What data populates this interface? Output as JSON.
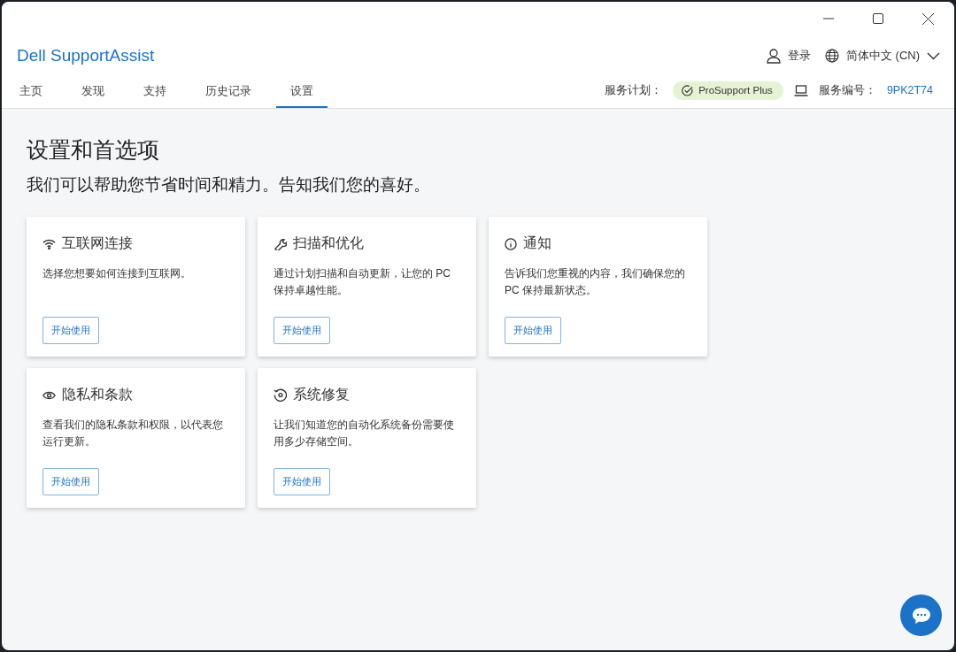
{
  "app": {
    "title": "Dell SupportAssist"
  },
  "account": {
    "sign_in": "登录",
    "language": "简体中文 (CN)"
  },
  "tabs": [
    {
      "label": "主页",
      "selected": false
    },
    {
      "label": "发现",
      "selected": false
    },
    {
      "label": "支持",
      "selected": false
    },
    {
      "label": "历史记录",
      "selected": false
    },
    {
      "label": "设置",
      "selected": true
    }
  ],
  "service": {
    "plan_label": "服务计划：",
    "plan": "ProSupport Plus",
    "tag_label": "服务编号：",
    "tag": "9PK2T74"
  },
  "page": {
    "title": "设置和首选项",
    "subtitle": "我们可以帮助您节省时间和精力。告知我们您的喜好。"
  },
  "cards": [
    {
      "kind": "wifi",
      "title": "互联网连接",
      "text": "选择您想要如何连接到互联网。",
      "button": "开始使用"
    },
    {
      "kind": "wrench",
      "title": "扫描和优化",
      "text": "通过计划扫描和自动更新，让您的 PC 保持卓越性能。",
      "button": "开始使用"
    },
    {
      "kind": "info",
      "title": "通知",
      "text": "告诉我们您重视的内容，我们确保您的 PC 保持最新状态。",
      "button": "开始使用"
    },
    {
      "kind": "eye",
      "title": "隐私和条款",
      "text": "查看我们的隐私条款和权限，以代表您运行更新。",
      "button": "开始使用"
    },
    {
      "kind": "restore",
      "title": "系统修复",
      "text": "让我们知道您的自动化系统备份需要使用多少存储空间。",
      "button": "开始使用"
    }
  ]
}
